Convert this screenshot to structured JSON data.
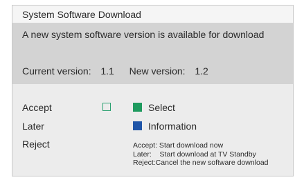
{
  "window": {
    "title": "System Software Download"
  },
  "message": "A new system software version is available for download",
  "versions": {
    "current_label": "Current version:",
    "current_value": "1.1",
    "new_label": "New version:",
    "new_value": "1.2"
  },
  "options": {
    "accept": "Accept",
    "later": "Later",
    "reject": "Reject"
  },
  "keys": {
    "select_label": "Select",
    "select_color": "#1e9a5e",
    "info_label": "Information",
    "info_color": "#1f55a8"
  },
  "help": {
    "accept": "Accept: Start download now",
    "later": "Later:    Start download at TV Standby",
    "reject": "Reject:Cancel the new software download"
  },
  "colors": {
    "title_bar": "#f5f5f5",
    "info_band": "#d3d3d3",
    "panel": "#ececec",
    "checkbox_border": "#2aa070"
  }
}
